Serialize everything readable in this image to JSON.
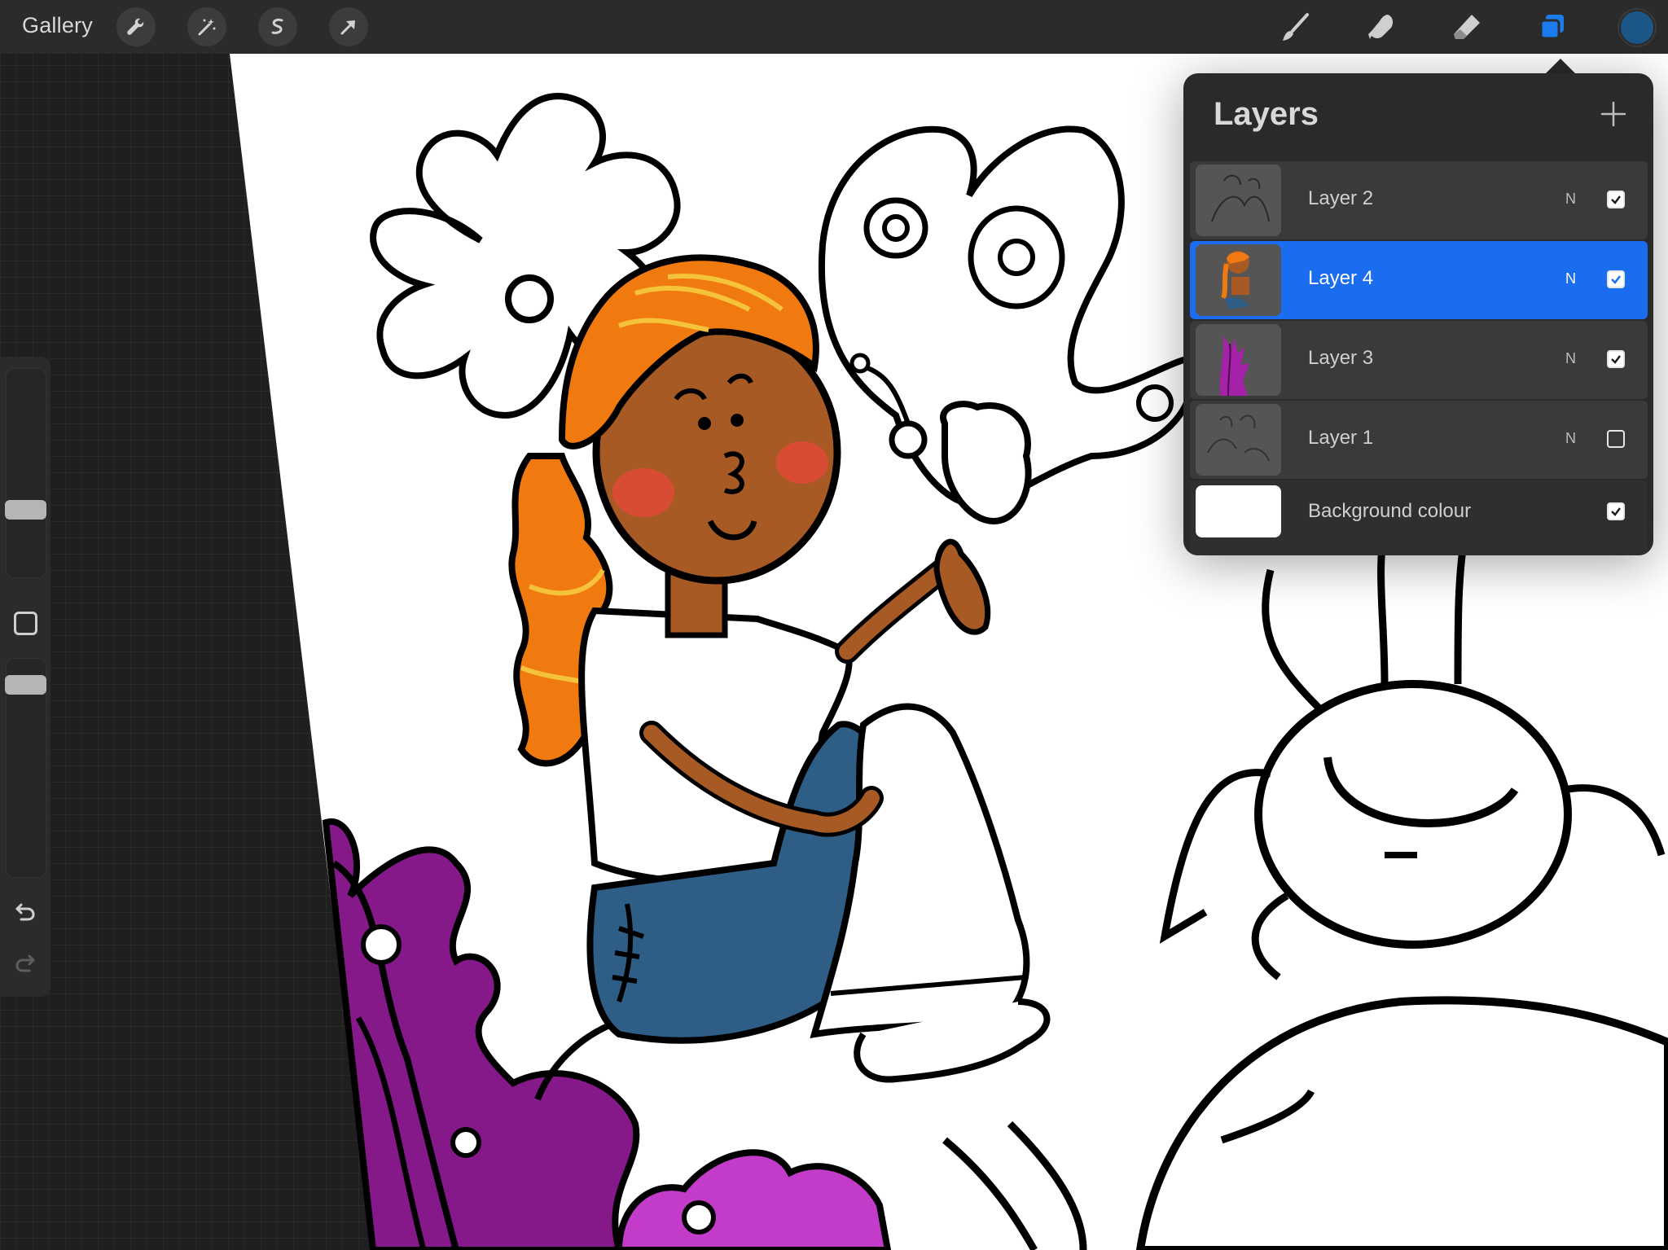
{
  "topbar": {
    "gallery_label": "Gallery",
    "left_tools": [
      "wrench-icon",
      "magic-wand-icon",
      "selection-icon",
      "move-arrow-icon"
    ],
    "right_tools": [
      "brush-icon",
      "smudge-icon",
      "eraser-icon",
      "layers-icon"
    ],
    "current_color": "#1c5788",
    "layers_active_color": "#1b7cf0"
  },
  "sidebar": {
    "brush_size": 0.7,
    "opacity": 0.76,
    "tools": [
      "modify-button",
      "undo-icon",
      "redo-icon"
    ]
  },
  "layers_panel": {
    "title": "Layers",
    "add_icon": "plus-icon",
    "layers": [
      {
        "name": "Layer 2",
        "blend": "N",
        "visible": true,
        "selected": false
      },
      {
        "name": "Layer 4",
        "blend": "N",
        "visible": true,
        "selected": true
      },
      {
        "name": "Layer 3",
        "blend": "N",
        "visible": true,
        "selected": false
      },
      {
        "name": "Layer 1",
        "blend": "N",
        "visible": false,
        "selected": false
      }
    ],
    "background": {
      "name": "Background colour",
      "visible": true,
      "color": "#ffffff"
    }
  },
  "colors": {
    "selected_row": "#1b6df0",
    "hair_orange": "#f07a10",
    "skin": "#a75a24",
    "jeans": "#2e5e85",
    "seaweed_purple": "#8a1d8c"
  }
}
